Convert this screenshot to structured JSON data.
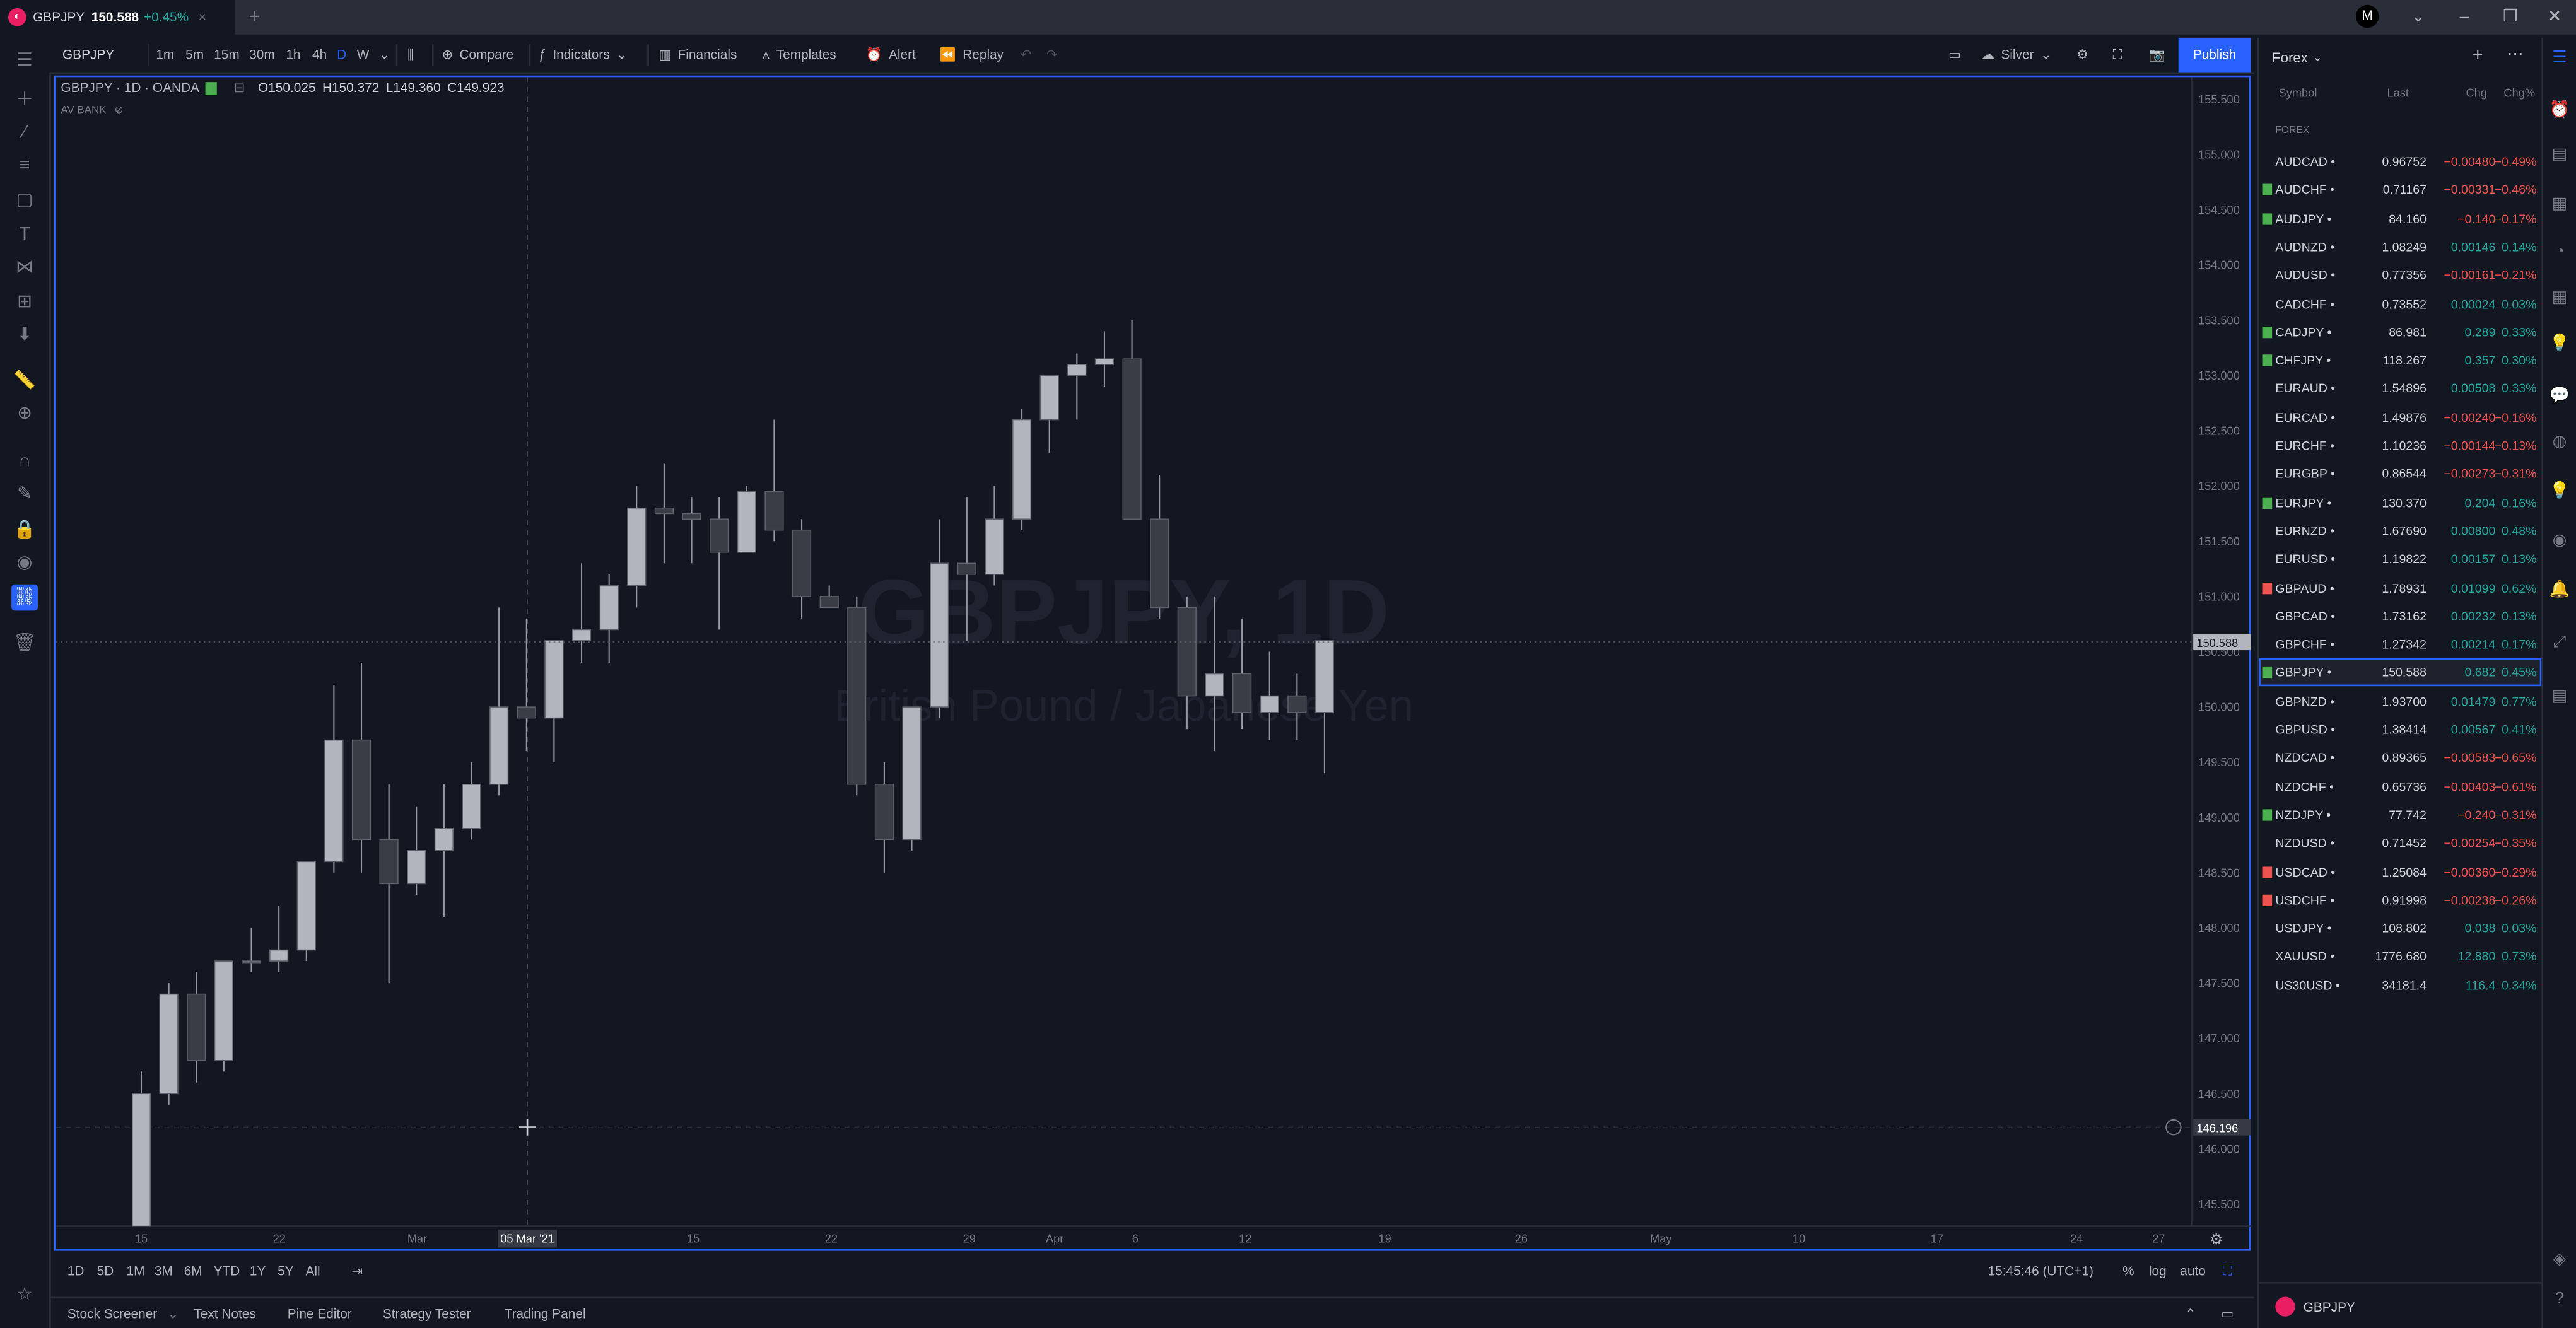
{
  "tab": {
    "symbol": "GBPJPY",
    "price": "150.588",
    "change": "+0.45%",
    "close": "×"
  },
  "window": {
    "new_tab": "+"
  },
  "toolbar": {
    "symbol": "GBPJPY",
    "timeframes": [
      "1m",
      "5m",
      "15m",
      "30m",
      "1h",
      "4h",
      "D",
      "W"
    ],
    "active_timeframe": "D",
    "compare": "Compare",
    "indicators": "Indicators",
    "financials": "Financials",
    "templates": "Templates",
    "alert": "Alert",
    "replay": "Replay",
    "plan": "Silver",
    "publish": "Publish"
  },
  "legend": {
    "title": "GBPJPY · 1D · OANDA",
    "open": "O150.025",
    "high": "H150.372",
    "low": "L149.360",
    "close": "C149.923",
    "indicator": "AV BANK"
  },
  "watermark": {
    "line1": "GBPJPY, 1D",
    "line2": "British Pound / Japanese Yen"
  },
  "chart_data": {
    "type": "candlestick",
    "x_ticks": [
      "15",
      "22",
      "Mar",
      "15",
      "22",
      "29",
      "Apr",
      "6",
      "12",
      "19",
      "26",
      "May",
      "10",
      "17",
      "24",
      "27"
    ],
    "crosshair_date": "05 Mar '21",
    "y_ticks": [
      "155.500",
      "155.000",
      "154.500",
      "154.000",
      "153.500",
      "153.000",
      "152.500",
      "152.000",
      "151.500",
      "151.000",
      "150.500",
      "150.000",
      "149.500",
      "149.000",
      "148.500",
      "148.000",
      "147.500",
      "147.000",
      "146.500",
      "146.000",
      "145.500"
    ],
    "ylim": [
      145.3,
      155.7
    ],
    "last_price": "150.588",
    "crosshair_price": "146.196",
    "candles": [
      {
        "o": 145.3,
        "h": 146.7,
        "l": 145.3,
        "c": 146.5
      },
      {
        "o": 146.5,
        "h": 147.5,
        "l": 146.4,
        "c": 147.4
      },
      {
        "o": 147.4,
        "h": 147.6,
        "l": 146.6,
        "c": 146.8
      },
      {
        "o": 146.8,
        "h": 147.7,
        "l": 146.7,
        "c": 147.7
      },
      {
        "o": 147.7,
        "h": 148.0,
        "l": 147.6,
        "c": 147.7
      },
      {
        "o": 147.7,
        "h": 148.2,
        "l": 147.6,
        "c": 147.8
      },
      {
        "o": 147.8,
        "h": 148.6,
        "l": 147.7,
        "c": 148.6
      },
      {
        "o": 148.6,
        "h": 150.2,
        "l": 148.5,
        "c": 149.7
      },
      {
        "o": 149.7,
        "h": 150.4,
        "l": 148.5,
        "c": 148.8
      },
      {
        "o": 148.8,
        "h": 149.3,
        "l": 147.5,
        "c": 148.4
      },
      {
        "o": 148.4,
        "h": 149.1,
        "l": 148.3,
        "c": 148.7
      },
      {
        "o": 148.7,
        "h": 149.3,
        "l": 148.1,
        "c": 148.9
      },
      {
        "o": 148.9,
        "h": 149.5,
        "l": 148.8,
        "c": 149.3
      },
      {
        "o": 149.3,
        "h": 150.9,
        "l": 149.2,
        "c": 150.0
      },
      {
        "o": 150.0,
        "h": 150.8,
        "l": 149.6,
        "c": 149.9
      },
      {
        "o": 149.9,
        "h": 150.6,
        "l": 149.5,
        "c": 150.6
      },
      {
        "o": 150.6,
        "h": 151.3,
        "l": 150.4,
        "c": 150.7
      },
      {
        "o": 150.7,
        "h": 151.2,
        "l": 150.4,
        "c": 151.1
      },
      {
        "o": 151.1,
        "h": 152.0,
        "l": 150.9,
        "c": 151.8
      },
      {
        "o": 151.8,
        "h": 152.2,
        "l": 151.3,
        "c": 151.75
      },
      {
        "o": 151.75,
        "h": 151.9,
        "l": 151.3,
        "c": 151.7
      },
      {
        "o": 151.7,
        "h": 151.9,
        "l": 150.7,
        "c": 151.4
      },
      {
        "o": 151.4,
        "h": 152.0,
        "l": 151.4,
        "c": 151.95
      },
      {
        "o": 151.95,
        "h": 152.6,
        "l": 151.5,
        "c": 151.6
      },
      {
        "o": 151.6,
        "h": 151.7,
        "l": 150.8,
        "c": 151.0
      },
      {
        "o": 151.0,
        "h": 151.1,
        "l": 150.9,
        "c": 150.9
      },
      {
        "o": 150.9,
        "h": 151.0,
        "l": 149.2,
        "c": 149.3
      },
      {
        "o": 149.3,
        "h": 149.5,
        "l": 148.5,
        "c": 148.8
      },
      {
        "o": 148.8,
        "h": 150.0,
        "l": 148.7,
        "c": 150.0
      },
      {
        "o": 150.0,
        "h": 151.7,
        "l": 149.9,
        "c": 151.3
      },
      {
        "o": 151.3,
        "h": 151.9,
        "l": 150.6,
        "c": 151.2
      },
      {
        "o": 151.2,
        "h": 152.0,
        "l": 151.1,
        "c": 151.7
      },
      {
        "o": 151.7,
        "h": 152.7,
        "l": 151.6,
        "c": 152.6
      },
      {
        "o": 152.6,
        "h": 153.0,
        "l": 152.3,
        "c": 153.0
      },
      {
        "o": 153.0,
        "h": 153.2,
        "l": 152.6,
        "c": 153.1
      },
      {
        "o": 153.1,
        "h": 153.4,
        "l": 152.9,
        "c": 153.15
      },
      {
        "o": 153.15,
        "h": 153.5,
        "l": 152.0,
        "c": 151.7
      },
      {
        "o": 151.7,
        "h": 152.1,
        "l": 150.8,
        "c": 150.9
      },
      {
        "o": 150.9,
        "h": 151.0,
        "l": 149.8,
        "c": 150.1
      },
      {
        "o": 150.1,
        "h": 151.0,
        "l": 149.6,
        "c": 150.3
      },
      {
        "o": 150.3,
        "h": 150.8,
        "l": 149.8,
        "c": 149.95
      },
      {
        "o": 149.95,
        "h": 150.5,
        "l": 149.7,
        "c": 150.1
      },
      {
        "o": 150.1,
        "h": 150.3,
        "l": 149.7,
        "c": 149.95
      },
      {
        "o": 149.95,
        "h": 150.6,
        "l": 149.4,
        "c": 150.6
      }
    ]
  },
  "range": {
    "buttons": [
      "1D",
      "5D",
      "1M",
      "3M",
      "6M",
      "YTD",
      "1Y",
      "5Y",
      "All"
    ],
    "time": "15:45:46 (UTC+1)",
    "pct": "%",
    "log": "log",
    "auto": "auto"
  },
  "bottom_tabs": [
    "Stock Screener",
    "Text Notes",
    "Pine Editor",
    "Strategy Tester",
    "Trading Panel"
  ],
  "watchlist": {
    "title": "Forex",
    "columns": {
      "symbol": "Symbol",
      "last": "Last",
      "chg": "Chg",
      "chgp": "Chg%"
    },
    "section": "FOREX",
    "footer_symbol": "GBPJPY",
    "rows": [
      {
        "s": "AUDCAD",
        "l": "0.96752",
        "c": "−0.00480",
        "p": "−0.49%",
        "d": "dn",
        "f": ""
      },
      {
        "s": "AUDCHF",
        "l": "0.71167",
        "c": "−0.00331",
        "p": "−0.46%",
        "d": "dn",
        "f": "#4caf50"
      },
      {
        "s": "AUDJPY",
        "l": "84.160",
        "c": "−0.140",
        "p": "−0.17%",
        "d": "dn",
        "f": "#4caf50"
      },
      {
        "s": "AUDNZD",
        "l": "1.08249",
        "c": "0.00146",
        "p": "0.14%",
        "d": "up",
        "f": ""
      },
      {
        "s": "AUDUSD",
        "l": "0.77356",
        "c": "−0.00161",
        "p": "−0.21%",
        "d": "dn",
        "f": ""
      },
      {
        "s": "CADCHF",
        "l": "0.73552",
        "c": "0.00024",
        "p": "0.03%",
        "d": "up",
        "f": ""
      },
      {
        "s": "CADJPY",
        "l": "86.981",
        "c": "0.289",
        "p": "0.33%",
        "d": "up",
        "f": "#4caf50"
      },
      {
        "s": "CHFJPY",
        "l": "118.267",
        "c": "0.357",
        "p": "0.30%",
        "d": "up",
        "f": "#4caf50"
      },
      {
        "s": "EURAUD",
        "l": "1.54896",
        "c": "0.00508",
        "p": "0.33%",
        "d": "up",
        "f": ""
      },
      {
        "s": "EURCAD",
        "l": "1.49876",
        "c": "−0.00240",
        "p": "−0.16%",
        "d": "dn",
        "f": ""
      },
      {
        "s": "EURCHF",
        "l": "1.10236",
        "c": "−0.00144",
        "p": "−0.13%",
        "d": "dn",
        "f": ""
      },
      {
        "s": "EURGBP",
        "l": "0.86544",
        "c": "−0.00273",
        "p": "−0.31%",
        "d": "dn",
        "f": ""
      },
      {
        "s": "EURJPY",
        "l": "130.370",
        "c": "0.204",
        "p": "0.16%",
        "d": "up",
        "f": "#4caf50"
      },
      {
        "s": "EURNZD",
        "l": "1.67690",
        "c": "0.00800",
        "p": "0.48%",
        "d": "up",
        "f": ""
      },
      {
        "s": "EURUSD",
        "l": "1.19822",
        "c": "0.00157",
        "p": "0.13%",
        "d": "up",
        "f": ""
      },
      {
        "s": "GBPAUD",
        "l": "1.78931",
        "c": "0.01099",
        "p": "0.62%",
        "d": "up",
        "f": "#ef5350"
      },
      {
        "s": "GBPCAD",
        "l": "1.73162",
        "c": "0.00232",
        "p": "0.13%",
        "d": "up",
        "f": ""
      },
      {
        "s": "GBPCHF",
        "l": "1.27342",
        "c": "0.00214",
        "p": "0.17%",
        "d": "up",
        "f": ""
      },
      {
        "s": "GBPJPY",
        "l": "150.588",
        "c": "0.682",
        "p": "0.45%",
        "d": "up",
        "f": "#4caf50",
        "sel": true
      },
      {
        "s": "GBPNZD",
        "l": "1.93700",
        "c": "0.01479",
        "p": "0.77%",
        "d": "up",
        "f": ""
      },
      {
        "s": "GBPUSD",
        "l": "1.38414",
        "c": "0.00567",
        "p": "0.41%",
        "d": "up",
        "f": ""
      },
      {
        "s": "NZDCAD",
        "l": "0.89365",
        "c": "−0.00583",
        "p": "−0.65%",
        "d": "dn",
        "f": ""
      },
      {
        "s": "NZDCHF",
        "l": "0.65736",
        "c": "−0.00403",
        "p": "−0.61%",
        "d": "dn",
        "f": ""
      },
      {
        "s": "NZDJPY",
        "l": "77.742",
        "c": "−0.240",
        "p": "−0.31%",
        "d": "dn",
        "f": "#4caf50"
      },
      {
        "s": "NZDUSD",
        "l": "0.71452",
        "c": "−0.00254",
        "p": "−0.35%",
        "d": "dn",
        "f": ""
      },
      {
        "s": "USDCAD",
        "l": "1.25084",
        "c": "−0.00360",
        "p": "−0.29%",
        "d": "dn",
        "f": "#ef5350"
      },
      {
        "s": "USDCHF",
        "l": "0.91998",
        "c": "−0.00238",
        "p": "−0.26%",
        "d": "dn",
        "f": "#ef5350"
      },
      {
        "s": "USDJPY",
        "l": "108.802",
        "c": "0.038",
        "p": "0.03%",
        "d": "up",
        "f": ""
      },
      {
        "s": "XAUUSD",
        "l": "1776.680",
        "c": "12.880",
        "p": "0.73%",
        "d": "up",
        "f": ""
      },
      {
        "s": "US30USD",
        "l": "34181.4",
        "c": "116.4",
        "p": "0.34%",
        "d": "up",
        "f": ""
      }
    ]
  },
  "colors": {
    "bull": "#b2b5be",
    "bear": "#3a3d46",
    "accent": "#2962ff",
    "up": "#26a69a",
    "down": "#ef5350"
  }
}
